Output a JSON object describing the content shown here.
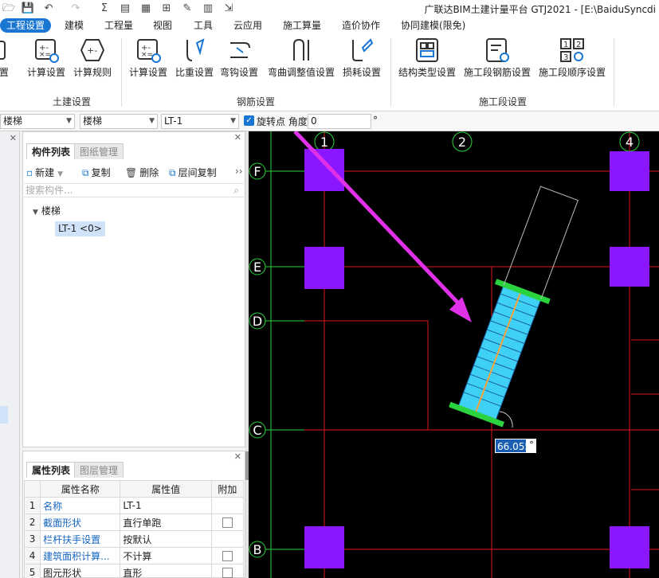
{
  "titlebar": {
    "app_title": "广联达BIM土建计量平台 GTJ2021 - [E:\\BaiduSyncdi"
  },
  "menu": {
    "tabs": [
      "工程设置",
      "建模",
      "工程量",
      "视图",
      "工具",
      "云应用",
      "施工算量",
      "造价协作",
      "协同建模(限免)"
    ]
  },
  "ribbon": {
    "partial_label": "置",
    "buttons": [
      "计算设置",
      "计算规则",
      "计算设置",
      "比重设置",
      "弯钩设置",
      "弯曲调整值设置",
      "损耗设置",
      "结构类型设置",
      "施工段钢筋设置",
      "施工段顺序设置"
    ],
    "groups": [
      "土建设置",
      "钢筋设置",
      "施工段设置"
    ]
  },
  "toolbar": {
    "combo1": "楼梯",
    "combo2": "楼梯",
    "combo3": "LT-1",
    "rotate_label": "旋转点 角度:",
    "angle_value": "0",
    "degree": "°"
  },
  "component_panel": {
    "tabs": [
      "构件列表",
      "图纸管理"
    ],
    "actions": [
      "新建",
      "复制",
      "删除",
      "层间复制"
    ],
    "search_placeholder": "搜索构件...",
    "tree_root": "楼梯",
    "tree_item": "LT-1 <0>"
  },
  "property_panel": {
    "tabs": [
      "属性列表",
      "图层管理"
    ],
    "headers": [
      "属性名称",
      "属性值",
      "附加"
    ],
    "rows": [
      {
        "no": "1",
        "name": "名称",
        "value": "LT-1",
        "extra": false
      },
      {
        "no": "2",
        "name": "截面形状",
        "value": "直行单跑",
        "extra": true
      },
      {
        "no": "3",
        "name": "栏杆扶手设置",
        "value": "按默认",
        "extra": false
      },
      {
        "no": "4",
        "name": "建筑面积计算...",
        "value": "不计算",
        "extra": true
      },
      {
        "no": "5",
        "name": "图元形状",
        "value": "直形",
        "extra": true
      }
    ]
  },
  "canvas": {
    "axis_top": [
      "1",
      "2",
      "4"
    ],
    "axis_left": [
      "F",
      "E",
      "D",
      "C",
      "B"
    ],
    "angle_input": "66.055",
    "angle_unit": "°"
  },
  "colors": {
    "accent": "#1976d2",
    "column": "#8a17ff",
    "grid_line": "#e0141e",
    "axis_green": "#2bd43f",
    "stair_fill": "#3fd0f5",
    "arrow": "#e030e8"
  }
}
